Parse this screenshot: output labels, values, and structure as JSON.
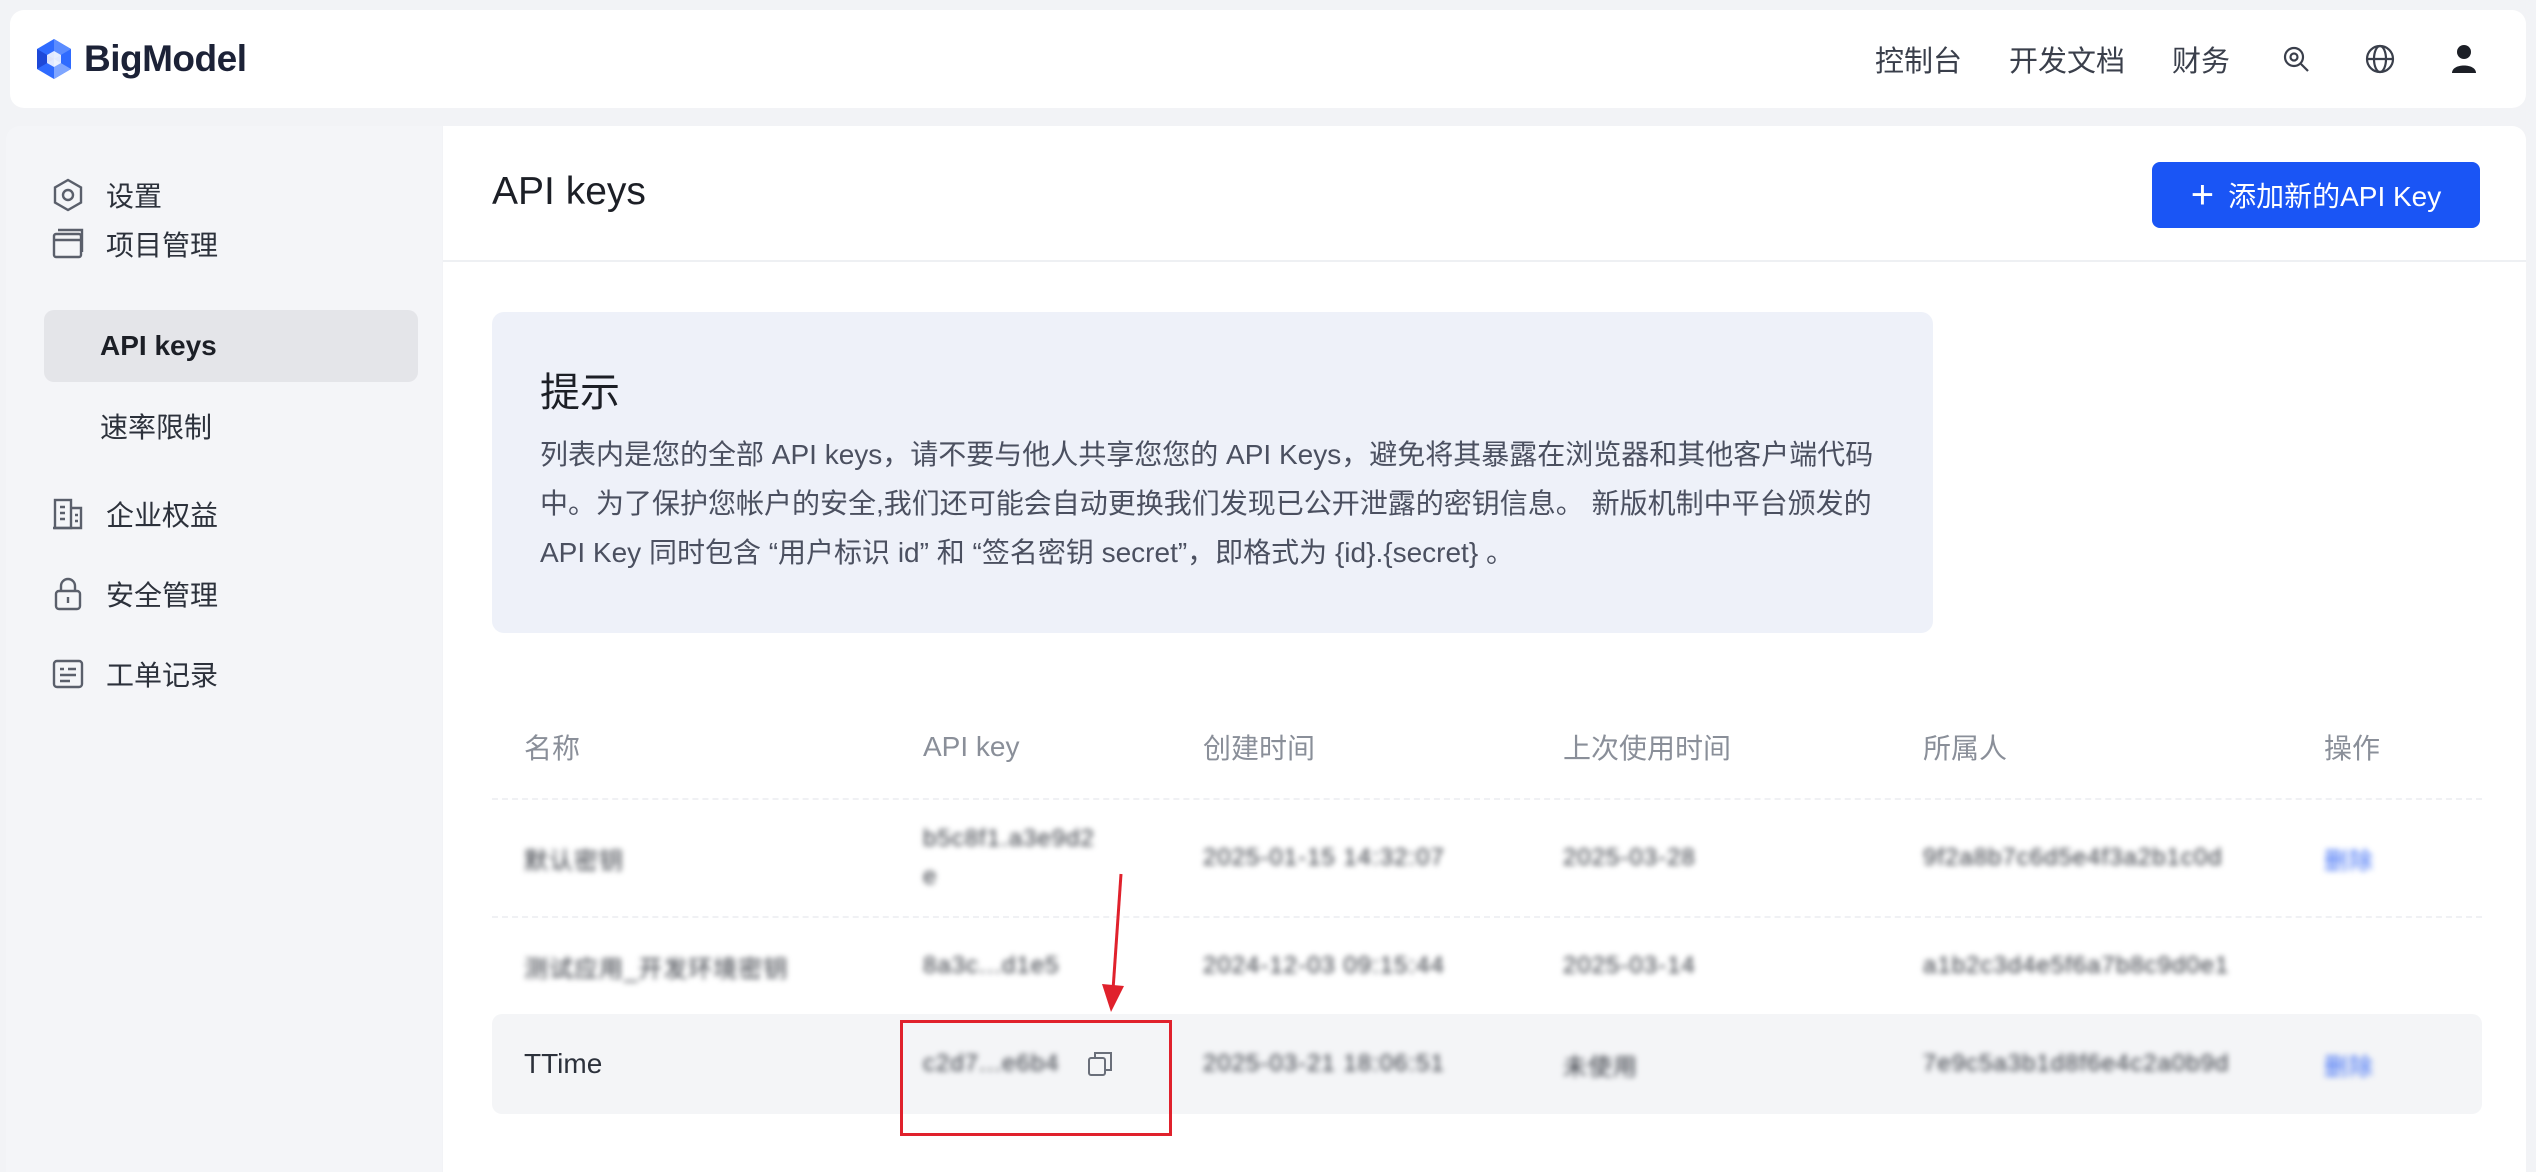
{
  "header": {
    "brand": "BigModel",
    "nav": [
      "控制台",
      "开发文档",
      "财务"
    ],
    "icons": [
      "support-icon",
      "globe-icon",
      "user-icon"
    ]
  },
  "sidebar": {
    "items": [
      {
        "label": "设置",
        "icon": "settings-icon"
      },
      {
        "label": "项目管理",
        "icon": "folder-icon"
      },
      {
        "label": "API keys",
        "icon": "",
        "active": true
      },
      {
        "label": "速率限制",
        "icon": ""
      },
      {
        "label": "企业权益",
        "icon": "building-icon"
      },
      {
        "label": "安全管理",
        "icon": "lock-icon"
      },
      {
        "label": "工单记录",
        "icon": "ticket-icon"
      }
    ]
  },
  "main": {
    "title": "API keys",
    "add_button": "添加新的API Key",
    "tip": {
      "title": "提示",
      "body": "列表内是您的全部 API keys，请不要与他人共享您您的 API Keys，避免将其暴露在浏览器和其他客户端代码中。为了保护您帐户的安全,我们还可能会自动更换我们发现已公开泄露的密钥信息。 新版机制中平台颁发的API Key 同时包含 “用户标识 id” 和 “签名密钥 secret”，即格式为 {id}.{secret} 。"
    },
    "table": {
      "headers": [
        "名称",
        "API key",
        "创建时间",
        "上次使用时间",
        "所属人",
        "操作"
      ],
      "rows": [
        {
          "name": "默认密钥",
          "key": "b5c8f1.a3e9d2 e",
          "created": "2025-01-15 14:32:07",
          "used": "2025-03-28",
          "owner": "9f2a8b7c6d5e4f3a2b1c0d",
          "op": "删除"
        },
        {
          "name": "测试应用_开发环境密钥",
          "key": "8a3c...d1e5",
          "created": "2024-12-03 09:15:44",
          "used": "2025-03-14",
          "owner": "a1b2c3d4e5f6a7b8c9d0e1",
          "op": ""
        },
        {
          "name": "TTime",
          "key": "c2d7...e6b4",
          "created": "2025-03-21 18:06:51",
          "used": "未使用",
          "owner": "7e9c5a3b1d8f6e4c2a0b9d",
          "op": "删除"
        }
      ]
    }
  },
  "annotation": {
    "color": "#e0212c"
  },
  "colors": {
    "accent": "#1a55f5",
    "tip_bg": "#eef1f9",
    "sidebar_active": "#e4e5e9"
  }
}
